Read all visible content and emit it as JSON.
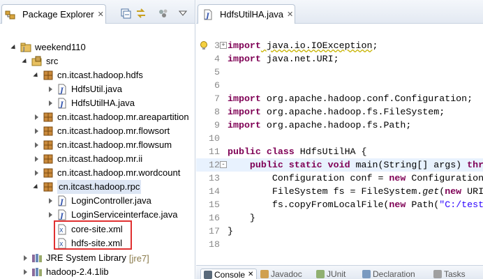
{
  "explorer": {
    "tab_label": "Package Explorer",
    "tab_close": "✕",
    "toolbar": [
      "collapse-all",
      "link-with-editor",
      "view-menu-options",
      "view-menu"
    ]
  },
  "tree": {
    "project": "weekend110",
    "src": "src",
    "pkg_hdfs": "cn.itcast.hadoop.hdfs",
    "file_hdfsutil": "HdfsUtil.java",
    "file_hdfsutilha": "HdfsUtilHA.java",
    "pkg_areapartition": "cn.itcast.hadoop.mr.areapartition",
    "pkg_flowsort": "cn.itcast.hadoop.mr.flowsort",
    "pkg_flowsum": "cn.itcast.hadoop.mr.flowsum",
    "pkg_ii": "cn.itcast.hadoop.mr.ii",
    "pkg_wordcount": "cn.itcast.hadoop.mr.wordcount",
    "pkg_rpc": "cn.itcast.hadoop.rpc",
    "file_logincontroller": "LoginController.java",
    "file_loginservice": "LoginServiceinterface.java",
    "file_coresite": "core-site.xml",
    "file_hdfssite": "hdfs-site.xml",
    "jre_label": "JRE System Library",
    "jre_deco": "[jre7]",
    "hadoop_lib": "hadoop-2.4.1lib"
  },
  "editor": {
    "tab_label": "HdfsUtilHA.java",
    "tab_close": "✕",
    "lines": [
      {
        "num": "3",
        "fold": "+",
        "parts": [
          [
            "kw",
            "import"
          ],
          [
            "warn",
            " java.io.IOException"
          ],
          [
            "",
            "; "
          ]
        ]
      },
      {
        "num": "4",
        "fold": "",
        "parts": [
          [
            "kw",
            "import"
          ],
          [
            "",
            " java.net.URI;"
          ]
        ]
      },
      {
        "num": "5",
        "fold": "",
        "parts": []
      },
      {
        "num": "6",
        "fold": "",
        "parts": []
      },
      {
        "num": "7",
        "fold": "",
        "parts": [
          [
            "kw",
            "import"
          ],
          [
            "",
            " org.apache.hadoop.conf.Configuration;"
          ]
        ]
      },
      {
        "num": "8",
        "fold": "",
        "parts": [
          [
            "kw",
            "import"
          ],
          [
            "",
            " org.apache.hadoop.fs.FileSystem;"
          ]
        ]
      },
      {
        "num": "9",
        "fold": "",
        "parts": [
          [
            "kw",
            "import"
          ],
          [
            "",
            " org.apache.hadoop.fs.Path;"
          ]
        ]
      },
      {
        "num": "10",
        "fold": "",
        "parts": []
      },
      {
        "num": "11",
        "fold": "",
        "parts": [
          [
            "kw",
            "public class"
          ],
          [
            "",
            " HdfsUtilHA {"
          ]
        ]
      },
      {
        "num": "12",
        "fold": "-",
        "parts": [
          [
            "",
            "    "
          ],
          [
            "kw",
            "public static void"
          ],
          [
            "",
            " main(String[] args) "
          ],
          [
            "kw",
            "thr"
          ]
        ]
      },
      {
        "num": "13",
        "fold": "",
        "parts": [
          [
            "",
            "        Configuration conf = "
          ],
          [
            "kw",
            "new"
          ],
          [
            "",
            " Configuration"
          ]
        ]
      },
      {
        "num": "14",
        "fold": "",
        "parts": [
          [
            "",
            "        FileSystem fs = FileSystem."
          ],
          [
            "italic",
            "get"
          ],
          [
            "",
            "("
          ],
          [
            "kw",
            "new"
          ],
          [
            "",
            " URI"
          ]
        ]
      },
      {
        "num": "15",
        "fold": "",
        "parts": [
          [
            "",
            "        fs.copyFromLocalFile("
          ],
          [
            "kw",
            "new"
          ],
          [
            "",
            " Path("
          ],
          [
            "str",
            "\"C:/test"
          ]
        ]
      },
      {
        "num": "16",
        "fold": "",
        "parts": [
          [
            "",
            "    }"
          ]
        ]
      },
      {
        "num": "17",
        "fold": "",
        "parts": [
          [
            "",
            "}"
          ]
        ]
      },
      {
        "num": "18",
        "fold": "",
        "parts": []
      }
    ]
  },
  "bottom_tabs": [
    {
      "label": "Console",
      "close": "✕"
    },
    {
      "label": "Javadoc"
    },
    {
      "label": "JUnit"
    },
    {
      "label": "Declaration"
    },
    {
      "label": "Tasks"
    }
  ]
}
